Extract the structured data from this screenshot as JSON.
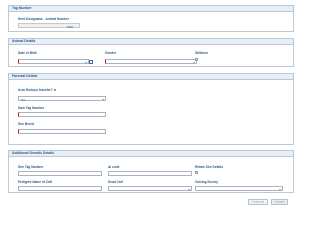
{
  "tag_number": {
    "header": "Tag Number",
    "herd_designator_label": "Herd Designator - Animal Number",
    "herd_designator_value": "1300"
  },
  "animal_details": {
    "header": "Animal Details",
    "date_of_birth_label": "Date of Birth",
    "date_of_birth_value": "",
    "gender_label": "Gender",
    "gender_value": "",
    "stillborn_label": "Stillborn"
  },
  "parental_details": {
    "header": "Parental Details",
    "embryo_label": "Is an Embryo transfer?",
    "embryo_value": "NO",
    "dam_tag_label": "Dam Tag Number",
    "dam_tag_value": "",
    "sire_breed_label": "Sire Breed",
    "sire_breed_value": ""
  },
  "additional_details": {
    "header": "Additional Genetic Details",
    "sire_tag_label": "Sire Tag Number",
    "ai_code_label": "AI code",
    "retain_sire_label": "Retain Sire Details",
    "pedigree_label": "Pedigree Name of Calf",
    "dead_calf_label": "Dead Calf",
    "calving_survey_label": "Calving Survey"
  },
  "footer": {
    "continue_label": "Continue",
    "cancel_label": "Cancel"
  },
  "colors": {
    "accent": "#2a5a8c",
    "header_bg": "#e7eef6",
    "required": "#e01010"
  }
}
